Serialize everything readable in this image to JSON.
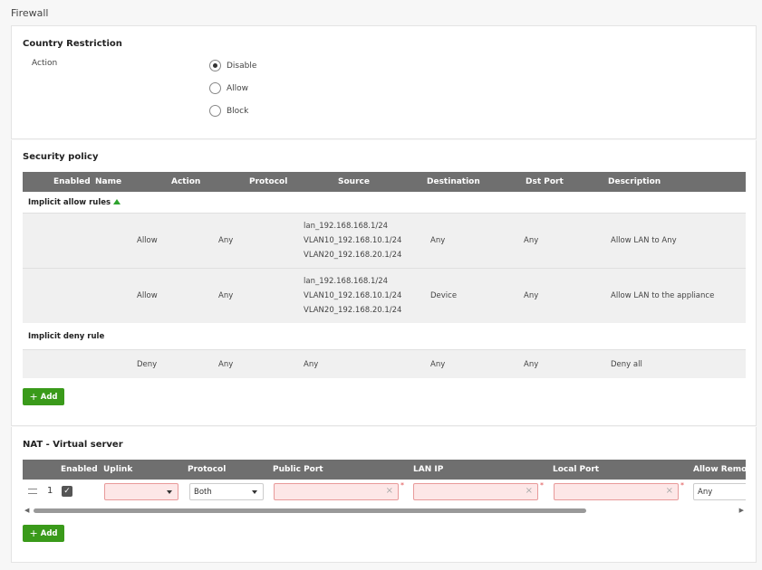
{
  "page": {
    "title": "Firewall"
  },
  "country_restriction": {
    "title": "Country Restriction",
    "action_label": "Action",
    "options": [
      {
        "label": "Disable",
        "checked": true
      },
      {
        "label": "Allow",
        "checked": false
      },
      {
        "label": "Block",
        "checked": false
      }
    ]
  },
  "security_policy": {
    "title": "Security policy",
    "columns": [
      "Enabled",
      "Name",
      "Action",
      "Protocol",
      "Source",
      "Destination",
      "Dst Port",
      "Description"
    ],
    "allow_group": "Implicit allow rules",
    "deny_group": "Implicit deny rule",
    "allow_rows": [
      {
        "action": "Allow",
        "protocol": "Any",
        "source": [
          "lan_192.168.168.1/24",
          "VLAN10_192.168.10.1/24",
          "VLAN20_192.168.20.1/24"
        ],
        "destination": "Any",
        "dst_port": "Any",
        "description": "Allow LAN to Any"
      },
      {
        "action": "Allow",
        "protocol": "Any",
        "source": [
          "lan_192.168.168.1/24",
          "VLAN10_192.168.10.1/24",
          "VLAN20_192.168.20.1/24"
        ],
        "destination": "Device",
        "dst_port": "Any",
        "description": "Allow LAN to the appliance"
      }
    ],
    "deny_row": {
      "action": "Deny",
      "protocol": "Any",
      "source": "Any",
      "destination": "Any",
      "dst_port": "Any",
      "description": "Deny all"
    },
    "add_label": "Add"
  },
  "nat": {
    "title": "NAT - Virtual server",
    "columns": [
      "Enabled",
      "Uplink",
      "Protocol",
      "Public Port",
      "LAN IP",
      "Local Port",
      "Allow Remote"
    ],
    "row": {
      "number": "1",
      "protocol": "Both",
      "allow_remote": "Any"
    },
    "add_label": "Add"
  },
  "icons": {
    "plus": "plus-icon",
    "check": "check-icon",
    "clear": "clear-icon",
    "chevron": "chevron-down-icon",
    "sort": "sort-up-icon",
    "drag": "drag-handle-icon"
  },
  "colors": {
    "accent": "#3a9a1a",
    "header": "#6f6f6f",
    "error_bg": "#fde7e7"
  }
}
